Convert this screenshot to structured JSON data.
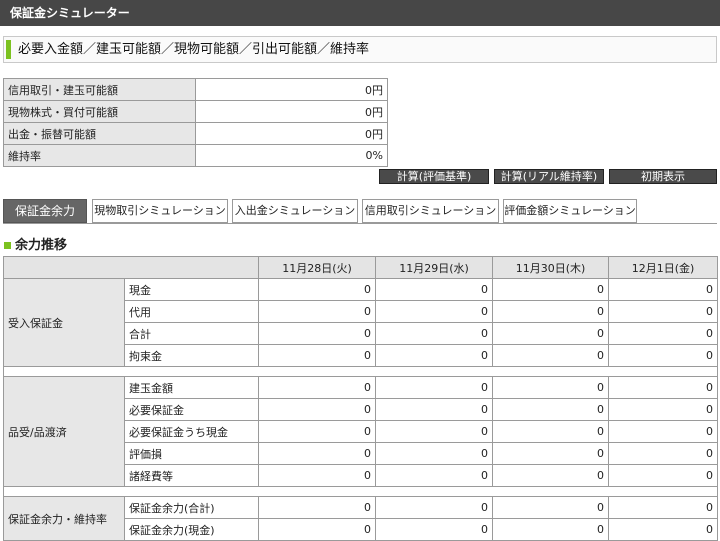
{
  "app": {
    "title": "保証金シミュレーター"
  },
  "section": {
    "title": "必要入金額／建玉可能額／現物可能額／引出可能額／維持率"
  },
  "summary": [
    {
      "label": "信用取引・建玉可能額",
      "value": "0円"
    },
    {
      "label": "現物株式・買付可能額",
      "value": "0円"
    },
    {
      "label": "出金・振替可能額",
      "value": "0円"
    },
    {
      "label": "維持率",
      "value": "0%"
    }
  ],
  "buttons": {
    "calc_eval": "計算(評価基準)",
    "calc_real": "計算(リアル維持率)",
    "initial": "初期表示"
  },
  "tabs": [
    {
      "label": "保証金余力",
      "active": true
    },
    {
      "label": "現物取引シミュレーション"
    },
    {
      "label": "入出金シミュレーション"
    },
    {
      "label": "信用取引シミュレーション"
    },
    {
      "label": "評価金額シミュレーション"
    }
  ],
  "balance": {
    "title": "余力推移",
    "dates": [
      "11月28日(火)",
      "11月29日(水)",
      "11月30日(木)",
      "12月1日(金)"
    ],
    "groups": [
      {
        "name": "受入保証金",
        "items": [
          {
            "label": "現金",
            "values": [
              "0",
              "0",
              "0",
              "0"
            ]
          },
          {
            "label": "代用",
            "values": [
              "0",
              "0",
              "0",
              "0"
            ]
          },
          {
            "label": "合計",
            "values": [
              "0",
              "0",
              "0",
              "0"
            ]
          },
          {
            "label": "拘束金",
            "values": [
              "0",
              "0",
              "0",
              "0"
            ]
          }
        ]
      },
      {
        "name": "品受/品渡済",
        "items": [
          {
            "label": "建玉金額",
            "values": [
              "0",
              "0",
              "0",
              "0"
            ]
          },
          {
            "label": "必要保証金",
            "values": [
              "0",
              "0",
              "0",
              "0"
            ]
          },
          {
            "label": "必要保証金うち現金",
            "values": [
              "0",
              "0",
              "0",
              "0"
            ]
          },
          {
            "label": "評価損",
            "values": [
              "0",
              "0",
              "0",
              "0"
            ]
          },
          {
            "label": "諸経費等",
            "values": [
              "0",
              "0",
              "0",
              "0"
            ]
          }
        ]
      },
      {
        "name": "保証金余力・維持率",
        "items": [
          {
            "label": "保証金余力(合計)",
            "values": [
              "0",
              "0",
              "0",
              "0"
            ]
          },
          {
            "label": "保証金余力(現金)",
            "values": [
              "0",
              "0",
              "0",
              "0"
            ]
          }
        ]
      }
    ]
  }
}
